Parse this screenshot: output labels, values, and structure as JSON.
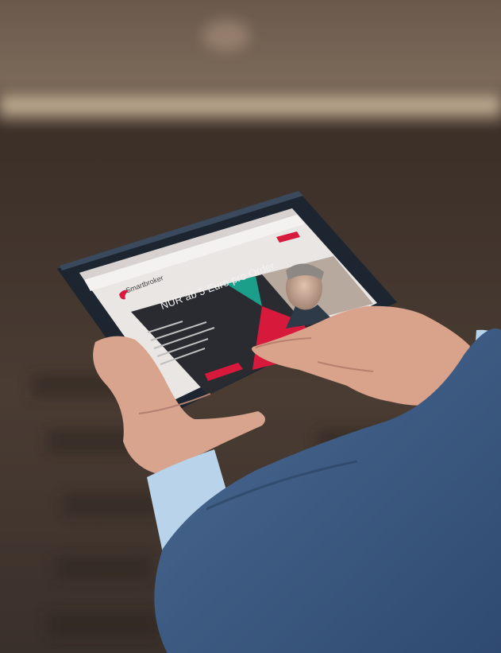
{
  "photo": {
    "subject": "hands-holding-tablet",
    "tablet_screen": {
      "brand_text": "Smartbroker",
      "headline": "NUR ab 5 Euro pro Order"
    }
  },
  "colors": {
    "background_dark": "#2b2420",
    "background_mid": "#5a4a3f",
    "wall_band": "#c9b59a",
    "tablet_frame": "#1c2530",
    "screen_dark": "#2a2b30",
    "accent_red": "#d71a3c",
    "accent_teal": "#1b9e8a",
    "suit_blue": "#3f5d86",
    "shirt_blue": "#b9d3ea",
    "skin": "#d9a891"
  }
}
